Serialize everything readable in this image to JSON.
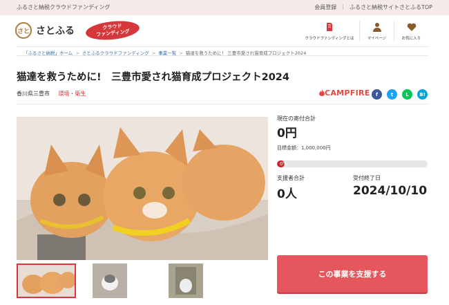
{
  "topbar": {
    "site_name": "ふるさと納税クラウドファンディング",
    "register": "会員登録",
    "separator": "|",
    "top_link": "ふるさと納税サイトさとふるTOP"
  },
  "header": {
    "logo_seal": "さと",
    "logo_text": "さとふる",
    "badge_line1": "クラウド",
    "badge_line2": "ファンディング",
    "nav": [
      {
        "label": "クラウドファンディングとは",
        "icon": "book-icon"
      },
      {
        "label": "マイページ",
        "icon": "person-icon"
      },
      {
        "label": "お気に入り",
        "icon": "heart-icon"
      }
    ]
  },
  "breadcrumb": {
    "items": [
      "「ふるさと納税」ホーム",
      "さとふるクラウドファンディング",
      "事業一覧",
      "猫達を救うために！ 三豊市愛され猫育成プロジェクト2024"
    ],
    "sep": ">"
  },
  "project": {
    "title": "猫達を救うために!　三豊市愛され猫育成プロジェクト2024",
    "location": "香川県三豊市",
    "category": "環境・衛生",
    "platform": "CAMPFIRE",
    "social": {
      "facebook": "f",
      "twitter": "t",
      "line": "L",
      "hatena": "B!"
    }
  },
  "stats": {
    "donated_label": "現在の寄付合計",
    "donated_value": "0円",
    "goal_text": "目標金額：1,000,000円",
    "progress_percent": 0,
    "progress_label": "0%",
    "supporters_label": "支援者合計",
    "supporters_value": "0人",
    "deadline_label": "受付終了日",
    "deadline_value": "2024/10/10"
  },
  "cta": {
    "label": "この事業を支援する"
  },
  "colors": {
    "accent": "#d6373a",
    "cta": "#e5575c",
    "topbar": "#f5ecea"
  }
}
